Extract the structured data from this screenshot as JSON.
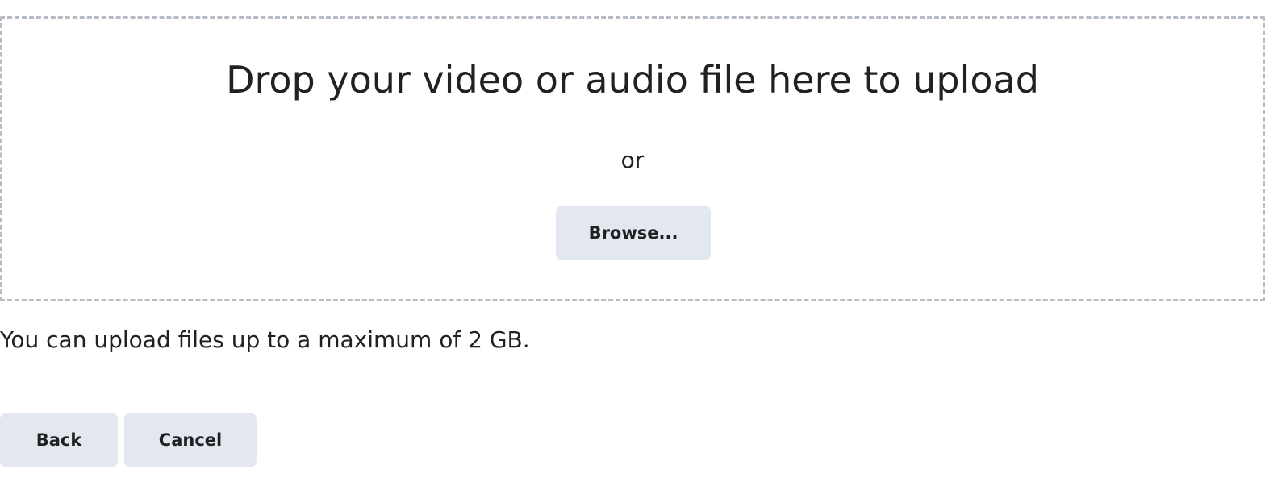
{
  "dropzone": {
    "title": "Drop your video or audio file here to upload",
    "separator": "or",
    "browse_label": "Browse..."
  },
  "upload_limit_note": "You can upload files up to a maximum of 2 GB.",
  "actions": {
    "back_label": "Back",
    "cancel_label": "Cancel"
  },
  "colors": {
    "button_background": "#e3e8f0",
    "dropzone_border": "#b6bcc4",
    "text": "#202122"
  }
}
